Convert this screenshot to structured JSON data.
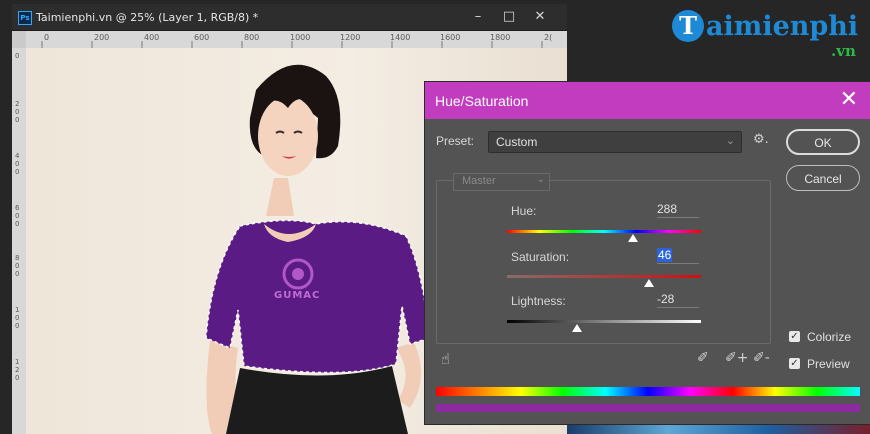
{
  "document_window": {
    "title": "Taimienphi.vn @ 25% (Layer 1, RGB/8) *",
    "app_badge": "Ps",
    "minimize_glyph": "–",
    "maximize_glyph": "□",
    "close_glyph": "✕",
    "ruler_top_labels": [
      "0",
      "200",
      "400",
      "600",
      "800",
      "1000",
      "1200",
      "1400",
      "1600",
      "1800",
      "2("
    ],
    "ruler_left_labels": [
      "0",
      "2\n0\n0",
      "4\n0\n0",
      "6\n0\n0",
      "8\n0\n0",
      "1\n0\n0",
      "1\n2\n0"
    ],
    "shirt_logo_text": "GUMAC"
  },
  "watermark": {
    "t_letter": "T",
    "brand": "aimienphi",
    "tld": ".vn"
  },
  "dialog": {
    "title": "Hue/Saturation",
    "close_glyph": "✕",
    "preset_label": "Preset:",
    "preset_value": "Custom",
    "preset_chevron": "⌄",
    "gear_glyph": "⚙.",
    "ok_label": "OK",
    "cancel_label": "Cancel",
    "channel_value": "Master",
    "channel_chevron": "⌄",
    "hue_label": "Hue:",
    "hue_value": "288",
    "saturation_label": "Saturation:",
    "saturation_value": "46",
    "lightness_label": "Lightness:",
    "lightness_value": "-28",
    "hue_level": 288,
    "hue_range": [
      -180,
      180
    ],
    "saturation_level": 46,
    "saturation_range": [
      -100,
      100
    ],
    "lightness_level": -28,
    "lightness_range": [
      -100,
      100
    ],
    "colorize_label": "Colorize",
    "colorize_checked": true,
    "preview_label": "Preview",
    "preview_checked": true,
    "check_glyph": "✓",
    "hand_glyph": "☝",
    "dropper_glyphs": [
      "✐",
      "✐+",
      "✐-"
    ],
    "accent_color": "#c23cc0",
    "result_bar_color": "#8c2aa0"
  }
}
